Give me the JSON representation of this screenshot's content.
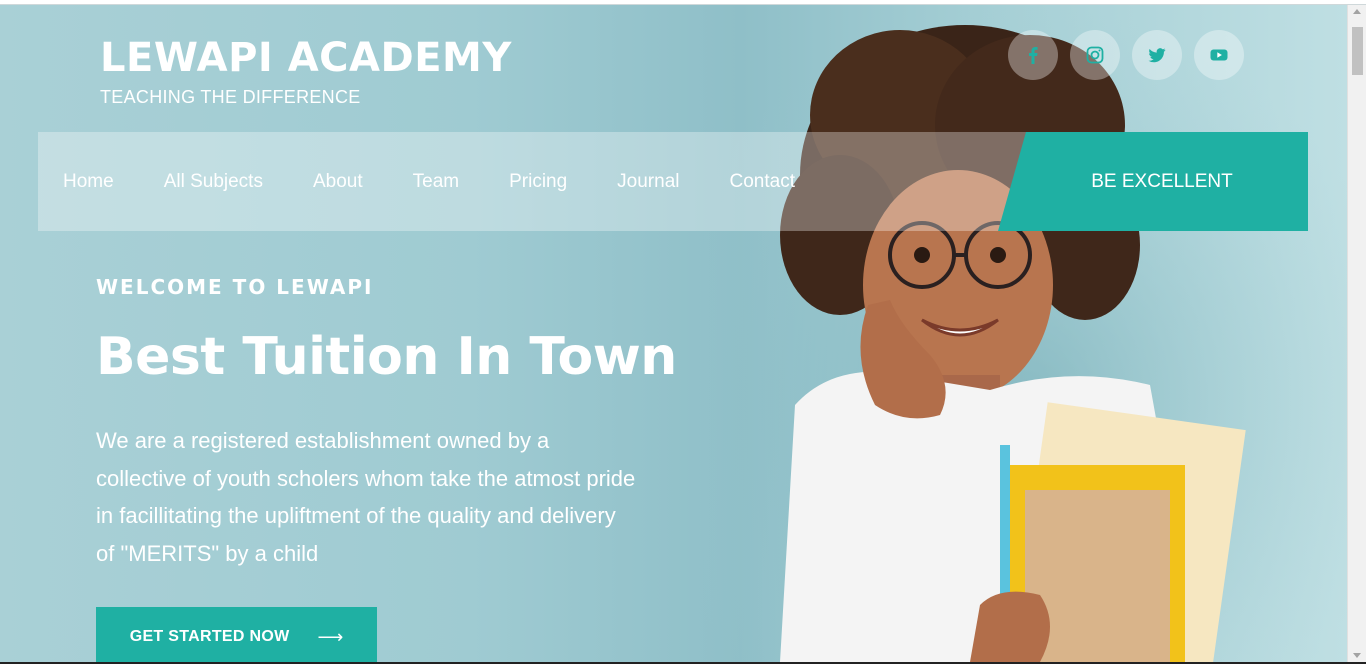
{
  "brand": {
    "title": "LEWAPI ACADEMY",
    "tagline": "TEACHING THE DIFFERENCE"
  },
  "social": [
    {
      "icon": "facebook-icon"
    },
    {
      "icon": "instagram-icon"
    },
    {
      "icon": "twitter-icon"
    },
    {
      "icon": "youtube-icon"
    }
  ],
  "nav": {
    "items": [
      "Home",
      "All Subjects",
      "About",
      "Team",
      "Pricing",
      "Journal",
      "Contact"
    ],
    "cta": "BE EXCELLENT"
  },
  "hero": {
    "welcome": "WELCOME TO LEWAPI",
    "headline": "Best Tuition In Town",
    "description": "We are a registered establishment owned by a collective of youth scholers whom take the atmost pride in facillitating the upliftment of the quality and delivery of \"MERITS\" by a child",
    "cta_label": "GET STARTED NOW",
    "cta_icon": "arrow-right-icon"
  },
  "colors": {
    "accent": "#1fb0a3",
    "hero_bg": "#a9d0d6",
    "text": "#ffffff"
  }
}
